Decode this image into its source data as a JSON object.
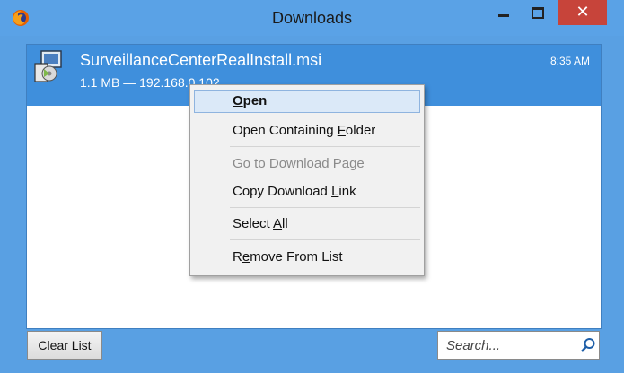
{
  "window": {
    "title": "Downloads"
  },
  "titlebar": {
    "minimize_label": "–",
    "maximize_label": "□",
    "close_label": "✕"
  },
  "download": {
    "name": "SurveillanceCenterRealInstall.msi",
    "meta": "1.1 MB — 192.168.0.102",
    "time": "8:35 AM"
  },
  "context_menu": {
    "items": [
      {
        "label": "Open",
        "accel": "O",
        "bold": true,
        "highlighted": true,
        "disabled": false
      },
      {
        "label": "Open Containing Folder",
        "accel": "F",
        "bold": false,
        "highlighted": false,
        "disabled": false
      },
      {
        "label": "Go to Download Page",
        "accel": "G",
        "bold": false,
        "highlighted": false,
        "disabled": true
      },
      {
        "label": "Copy Download Link",
        "accel": "L",
        "bold": false,
        "highlighted": false,
        "disabled": false
      },
      {
        "label": "Select All",
        "accel": "A",
        "bold": false,
        "highlighted": false,
        "disabled": false
      },
      {
        "label": "Remove From List",
        "accel": "e",
        "bold": false,
        "highlighted": false,
        "disabled": false
      }
    ]
  },
  "footer": {
    "clear_label": "Clear List",
    "search_placeholder": "Search..."
  },
  "colors": {
    "titlebar": "#5aa2e6",
    "selection": "#3f8fdc",
    "close": "#c7443a",
    "menu_highlight": "#dbe9f8"
  },
  "icons": [
    "firefox-icon",
    "package-icon",
    "search-icon"
  ]
}
